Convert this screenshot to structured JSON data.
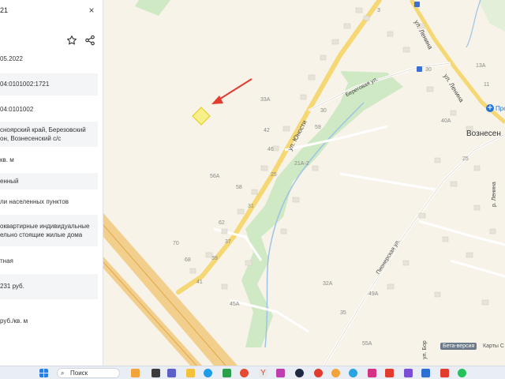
{
  "panel": {
    "title": "21",
    "close_glyph": "×",
    "rows": [
      {
        "text": "05.2022"
      },
      {
        "text": "04:0101002:1721"
      },
      {
        "text": "04:0101002"
      },
      {
        "text": "снoярский край, Березовский",
        "text2": "он, Вознесенский с/с"
      },
      {
        "text": "кв. м"
      },
      {
        "text": "енный"
      },
      {
        "text": "ли населенных пунктов"
      },
      {
        "text": "оквартирные индивидуальные",
        "text2": "ельно стоящие жилые дома"
      },
      {
        "text": "тная"
      },
      {
        "text": "231 руб."
      },
      {
        "text": "руб./кв. м"
      }
    ]
  },
  "collapse_glyph": "‹",
  "map": {
    "streets": {
      "yunosti": "ул. Юности",
      "lenina_top": "ул. Ленина",
      "lenina_mid": "ул. Ленина",
      "beregovaya": "Береговая ул.",
      "pionerskaya": "Пионерская ул.",
      "r_lenina": "р. Ленина",
      "ul_bottom": "ул. Бор"
    },
    "town": "Вознесен",
    "beta_badge": "Бета-версия",
    "karty": "Карты С",
    "poi": "Про",
    "labels": [
      {
        "t": "3"
      },
      {
        "t": "33А"
      },
      {
        "t": "42"
      },
      {
        "t": "46"
      },
      {
        "t": "56А"
      },
      {
        "t": "58"
      },
      {
        "t": "62"
      },
      {
        "t": "70"
      },
      {
        "t": "68"
      },
      {
        "t": "37"
      },
      {
        "t": "39"
      },
      {
        "t": "41"
      },
      {
        "t": "45А"
      },
      {
        "t": "31"
      },
      {
        "t": "25"
      },
      {
        "t": "59"
      },
      {
        "t": "30"
      },
      {
        "t": "21А-2"
      },
      {
        "t": "32А"
      },
      {
        "t": "49А"
      },
      {
        "t": "55А"
      },
      {
        "t": "30"
      },
      {
        "t": "40А"
      },
      {
        "t": "13А"
      },
      {
        "t": "11"
      },
      {
        "t": "25"
      },
      {
        "t": "35"
      }
    ]
  },
  "taskbar": {
    "search_label": "Поиск"
  }
}
